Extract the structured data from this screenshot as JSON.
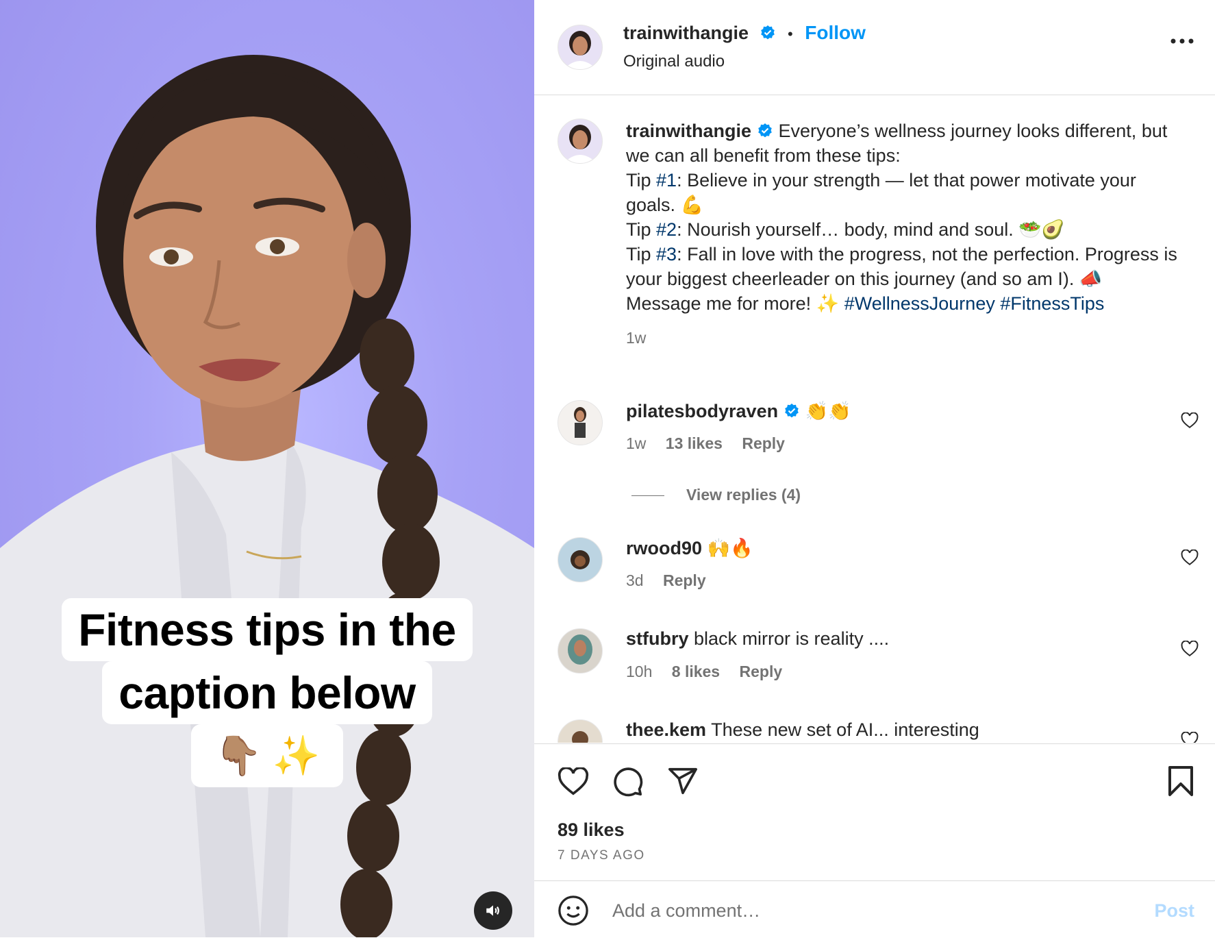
{
  "media": {
    "overlay_line1": "Fitness tips in the",
    "overlay_line2": "caption below",
    "overlay_emoji": "👇🏽 ✨",
    "sound_icon": "speaker-icon"
  },
  "header": {
    "username": "trainwithangie",
    "separator": "•",
    "follow_label": "Follow",
    "subtitle": "Original audio",
    "more_icon": "more-options-icon"
  },
  "caption": {
    "username": "trainwithangie",
    "lines": [
      "Everyone’s wellness journey looks different, but we can all benefit from these tips:",
      "Tip ",
      "#1",
      ": Believe in your strength — let that power motivate your goals. 💪",
      "Tip ",
      "#2",
      ": Nourish yourself… body, mind and soul. 🥗🥑",
      "Tip ",
      "#3",
      ": Fall in love with the progress, not the perfection. Progress is your biggest cheerleader on this journey (and so am I). 📣",
      "Message me for more! ✨ ",
      "#WellnessJourney",
      " ",
      "#FitnessTips"
    ],
    "time": "1w"
  },
  "comments": [
    {
      "username": "pilatesbodyraven",
      "verified": true,
      "text": "👏👏",
      "time": "1w",
      "likes": "13 likes",
      "reply": "Reply"
    },
    {
      "username": "rwood90",
      "verified": false,
      "text": "🙌🔥",
      "time": "3d",
      "likes": "",
      "reply": "Reply"
    },
    {
      "username": "stfubry",
      "verified": false,
      "text": "black mirror is reality ....",
      "time": "10h",
      "likes": "8 likes",
      "reply": "Reply"
    },
    {
      "username": "thee.kem",
      "verified": false,
      "text": "These new set of AI... interesting",
      "time": "",
      "likes": "",
      "reply": ""
    }
  ],
  "view_replies": "View replies (4)",
  "actions": {
    "likes": "89 likes",
    "ago": "7 DAYS AGO"
  },
  "add_comment": {
    "placeholder": "Add a comment…",
    "post_label": "Post"
  },
  "colors": {
    "accent": "#0095f6",
    "hashtag": "#00376b",
    "verified": "#0095f6",
    "muted": "#737373",
    "media_bg": "#a7a2f6"
  }
}
